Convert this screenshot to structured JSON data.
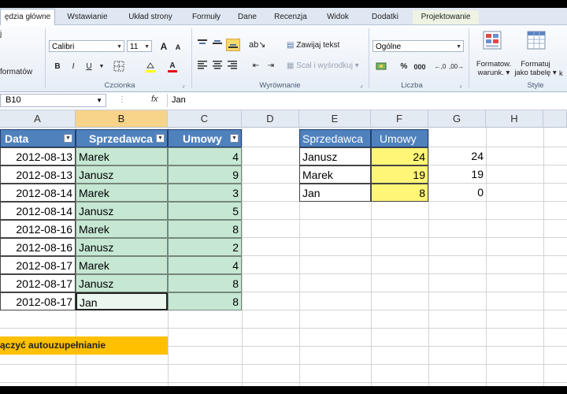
{
  "ribbon_tabs": [
    "ędzia główne",
    "Wstawianie",
    "Układ strony",
    "Formuły",
    "Dane",
    "Recenzja",
    "Widok",
    "Dodatki",
    "Projektowanie"
  ],
  "ribbon": {
    "clipboard": {
      "label_fragment": "formatów",
      "icon_fragment": "j"
    },
    "font": {
      "name": "Calibri",
      "size": "11",
      "group_label": "Czcionka",
      "bold": "B",
      "italic": "I",
      "underline": "U",
      "grow": "A",
      "shrink": "A",
      "font_color": "A"
    },
    "alignment": {
      "wrap_text": "Zawijaj tekst",
      "merge": "Scal i wyśrodkuj",
      "group_label": "Wyrównanie"
    },
    "number": {
      "format": "Ogólne",
      "group_label": "Liczba",
      "percent": "%",
      "thousands": "000"
    },
    "styles": {
      "conditional_label_1": "Formatow.",
      "conditional_label_2": "warunk.",
      "table_label_1": "Formatuj",
      "table_label_2": "jako tabelę",
      "group_label": "Style",
      "extra": "k"
    }
  },
  "formula_bar": {
    "name_box": "B10",
    "fx": "fx",
    "content": "Jan"
  },
  "columns": [
    "A",
    "B",
    "C",
    "D",
    "E",
    "F",
    "G",
    "H"
  ],
  "table1": {
    "headers": [
      "Data",
      "Sprzedawca",
      "Umowy"
    ],
    "rows": [
      [
        "2012-08-13",
        "Marek",
        "4"
      ],
      [
        "2012-08-13",
        "Janusz",
        "9"
      ],
      [
        "2012-08-14",
        "Marek",
        "3"
      ],
      [
        "2012-08-14",
        "Janusz",
        "5"
      ],
      [
        "2012-08-16",
        "Marek",
        "8"
      ],
      [
        "2012-08-16",
        "Janusz",
        "2"
      ],
      [
        "2012-08-17",
        "Marek",
        "4"
      ],
      [
        "2012-08-17",
        "Janusz",
        "8"
      ],
      [
        "2012-08-17",
        "Jan",
        "8"
      ]
    ]
  },
  "table2": {
    "headers": [
      "Sprzedawca",
      "Umowy"
    ],
    "rows": [
      {
        "name": "Janusz",
        "umowy": "24",
        "g": "24"
      },
      {
        "name": "Marek",
        "umowy": "19",
        "g": "19"
      },
      {
        "name": "Jan",
        "umowy": "8",
        "g": "0"
      }
    ]
  },
  "note": "ączyć autouzupełnianie",
  "colors": {
    "header_blue": "#4f81bd",
    "green_fill": "#c6e8d3",
    "yellow_fill": "#fff576",
    "note_orange": "#ffc000"
  }
}
